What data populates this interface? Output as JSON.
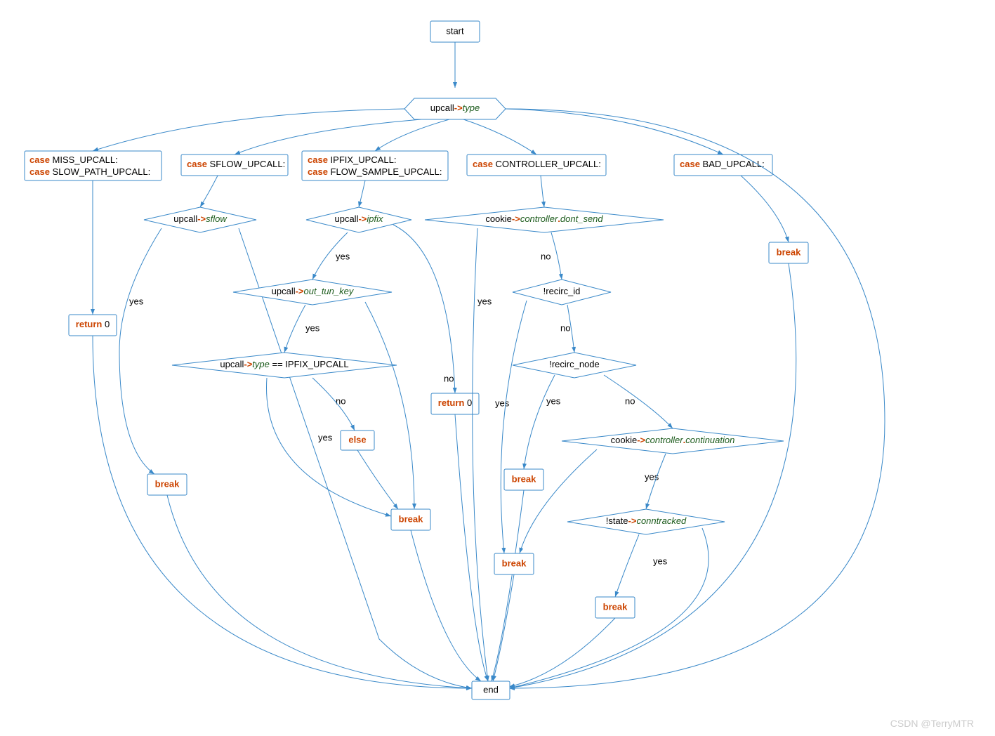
{
  "start": "start",
  "end": "end",
  "switch_expr": {
    "obj": "upcall",
    "op": "->",
    "field": "type"
  },
  "cases": {
    "miss": {
      "kw": "case",
      "labels": [
        "MISS_UPCALL:",
        "SLOW_PATH_UPCALL:"
      ]
    },
    "sflow": {
      "kw": "case",
      "labels": [
        "SFLOW_UPCALL:"
      ]
    },
    "ipfix": {
      "kw": "case",
      "labels": [
        "IPFIX_UPCALL:",
        "FLOW_SAMPLE_UPCALL:"
      ]
    },
    "controller": {
      "kw": "case",
      "labels": [
        "CONTROLLER_UPCALL:"
      ]
    },
    "bad": {
      "kw": "case",
      "labels": [
        "BAD_UPCALL:"
      ]
    }
  },
  "conds": {
    "sflow": {
      "obj": "upcall",
      "op": "->",
      "field": "sflow"
    },
    "ipfix": {
      "obj": "upcall",
      "op": "->",
      "field": "ipfix"
    },
    "out_tun_key": {
      "obj": "upcall",
      "op": "->",
      "field": "out_tun_key"
    },
    "type_eq": {
      "obj": "upcall",
      "op": "->",
      "field": "type",
      "op2": " == ",
      "rhs": "IPFIX_UPCALL"
    },
    "dont_send": {
      "obj": "cookie",
      "op": "->",
      "field": "controller",
      "op2": ".",
      "field2": "dont_send"
    },
    "recirc_id": {
      "neg": "!",
      "obj": "recirc_id"
    },
    "recirc_node": {
      "neg": "!",
      "obj": "recirc_node"
    },
    "continuation": {
      "obj": "cookie",
      "op": "->",
      "field": "controller",
      "op2": ".",
      "field2": "continuation"
    },
    "conntracked": {
      "neg": "!",
      "obj": "state",
      "op": "->",
      "field": "conntracked"
    }
  },
  "terms": {
    "return0": {
      "kw": "return ",
      "val": "0"
    },
    "break": "break",
    "else": "else"
  },
  "edge_labels": {
    "yes": "yes",
    "no": "no"
  },
  "watermark": "CSDN @TerryMTR"
}
